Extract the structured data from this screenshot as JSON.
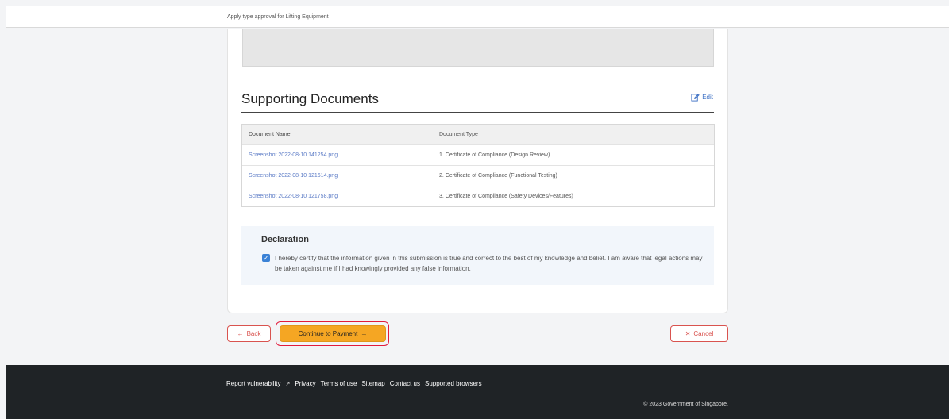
{
  "breadcrumb": "Apply type approval for Lifting Equipment",
  "section": {
    "title": "Supporting Documents",
    "edit_label": "Edit"
  },
  "documents": {
    "headers": [
      "Document Name",
      "Document Type"
    ],
    "rows": [
      {
        "name": "Screenshot 2022-08-10 141254.png",
        "type": "1. Certificate of Compliance (Design Review)"
      },
      {
        "name": "Screenshot 2022-08-10 121614.png",
        "type": "2. Certificate of Compliance (Functional Testing)"
      },
      {
        "name": "Screenshot 2022-08-10 121758.png",
        "type": "3. Certificate of Compliance (Safety Devices/Features)"
      }
    ]
  },
  "declaration": {
    "title": "Declaration",
    "checked": true,
    "text": "I hereby certify that the information given in this submission is true and correct to the best of my knowledge and belief. I am aware that legal actions may be taken against me if I had knowingly provided any false information."
  },
  "actions": {
    "back_label": "Back",
    "pay_label": "Continue to Payment",
    "cancel_label": "Cancel"
  },
  "footer": {
    "links": [
      "Report vulnerability",
      "Privacy",
      "Terms of use",
      "Sitemap",
      "Contact us",
      "Supported browsers"
    ],
    "copyright": "© 2023 Government of Singapore."
  },
  "colors": {
    "primary_button": "#f5a623",
    "danger_outline": "#d9534f",
    "highlight_outline": "#e21b3c",
    "link": "#5b7bc6",
    "footer_bg": "#1f2326"
  }
}
